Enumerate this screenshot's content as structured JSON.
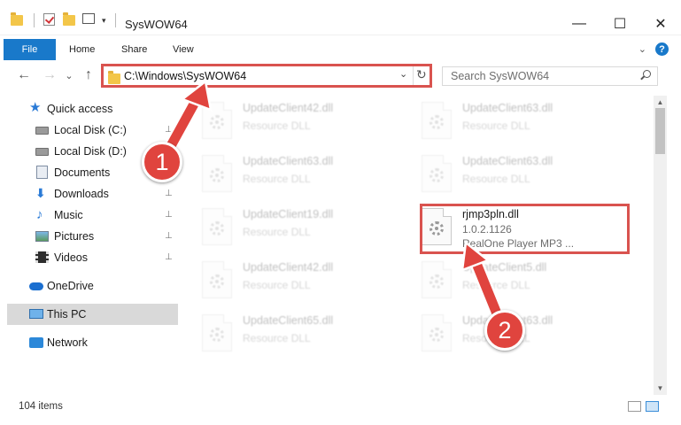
{
  "window": {
    "title": "SysWOW64",
    "controls": {
      "minimize": "—",
      "maximize": "☐",
      "close": "✕"
    }
  },
  "quick_access_toolbar": {
    "dropdown": "▾"
  },
  "ribbon": {
    "tabs": [
      {
        "label": "File",
        "active": true
      },
      {
        "label": "Home"
      },
      {
        "label": "Share"
      },
      {
        "label": "View"
      }
    ],
    "help": "?",
    "collapse": "⌄",
    "file_tab_color": "#1979ca"
  },
  "nav": {
    "back": "←",
    "forward": "→",
    "recent": "⌄",
    "up": "↑",
    "address": "C:\\Windows\\SysWOW64",
    "address_dropdown": "⌄",
    "refresh": "↻",
    "search_placeholder": "Search SysWOW64"
  },
  "sidebar": {
    "items": [
      {
        "label": "Quick access",
        "icon": "star-icon"
      },
      {
        "label": "Local Disk (C:)",
        "icon": "disk-icon",
        "pinned": true
      },
      {
        "label": "Local Disk (D:)",
        "icon": "disk-icon"
      },
      {
        "label": "Documents",
        "icon": "documents-icon",
        "pinned": true
      },
      {
        "label": "Downloads",
        "icon": "download-icon",
        "pinned": true
      },
      {
        "label": "Music",
        "icon": "music-icon",
        "pinned": true
      },
      {
        "label": "Pictures",
        "icon": "pictures-icon",
        "pinned": true
      },
      {
        "label": "Videos",
        "icon": "video-icon",
        "pinned": true
      },
      {
        "label": "OneDrive",
        "icon": "cloud-icon"
      },
      {
        "label": "This PC",
        "icon": "pc-icon",
        "selected": true
      },
      {
        "label": "Network",
        "icon": "network-icon"
      }
    ],
    "pin_glyph": "📌"
  },
  "files": [
    {
      "name": "UpdateClient42.dll",
      "desc": "Resource DLL"
    },
    {
      "name": "UpdateClient63.dll",
      "desc": "Resource DLL"
    },
    {
      "name": "UpdateClient63.dll",
      "desc": "Resource DLL"
    },
    {
      "name": "UpdateClient63.dll",
      "desc": "Resource DLL"
    },
    {
      "name": "UpdateClient19.dll",
      "desc": "Resource DLL"
    },
    {
      "name": "rjmp3pln.dll",
      "version": "1.0.2.1126",
      "desc": "RealOne Player MP3 ...",
      "highlighted": true
    },
    {
      "name": "UpdateClient42.dll",
      "desc": "Resource DLL"
    },
    {
      "name": "UpdateClient5.dll",
      "desc": "Resource DLL"
    },
    {
      "name": "UpdateClient65.dll",
      "desc": "Resource DLL"
    },
    {
      "name": "UpdateClient63.dll",
      "desc": "Resource DLL"
    }
  ],
  "status": {
    "item_count": "104 items"
  },
  "callouts": [
    "1",
    "2"
  ],
  "colors": {
    "annotation_red": "#d9534f",
    "callout_fill": "#e0443e",
    "selection_gray": "#d9d9d9"
  }
}
